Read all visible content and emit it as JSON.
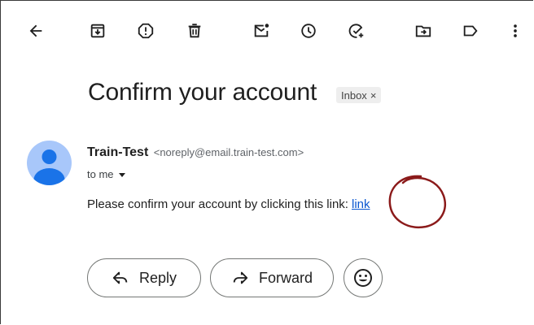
{
  "toolbar": {
    "icons": [
      "back-arrow-icon",
      "archive-icon",
      "report-spam-icon",
      "delete-icon",
      "mark-unread-icon",
      "snooze-icon",
      "add-to-tasks-icon",
      "move-to-icon",
      "label-icon",
      "more-vert-icon"
    ]
  },
  "email": {
    "subject": "Confirm your account",
    "label": "Inbox",
    "label_close": "×",
    "sender_name": "Train-Test",
    "sender_email": "<noreply@email.train-test.com>",
    "recipient": "to me",
    "body_text": "Please confirm your account by clicking this link:",
    "link_text": "link"
  },
  "actions": {
    "reply": "Reply",
    "forward": "Forward"
  },
  "colors": {
    "accent_link": "#0b57d0",
    "avatar_bg": "#a8c7fa",
    "avatar_fg": "#1a73e8",
    "annotation": "#8b1a1a"
  }
}
